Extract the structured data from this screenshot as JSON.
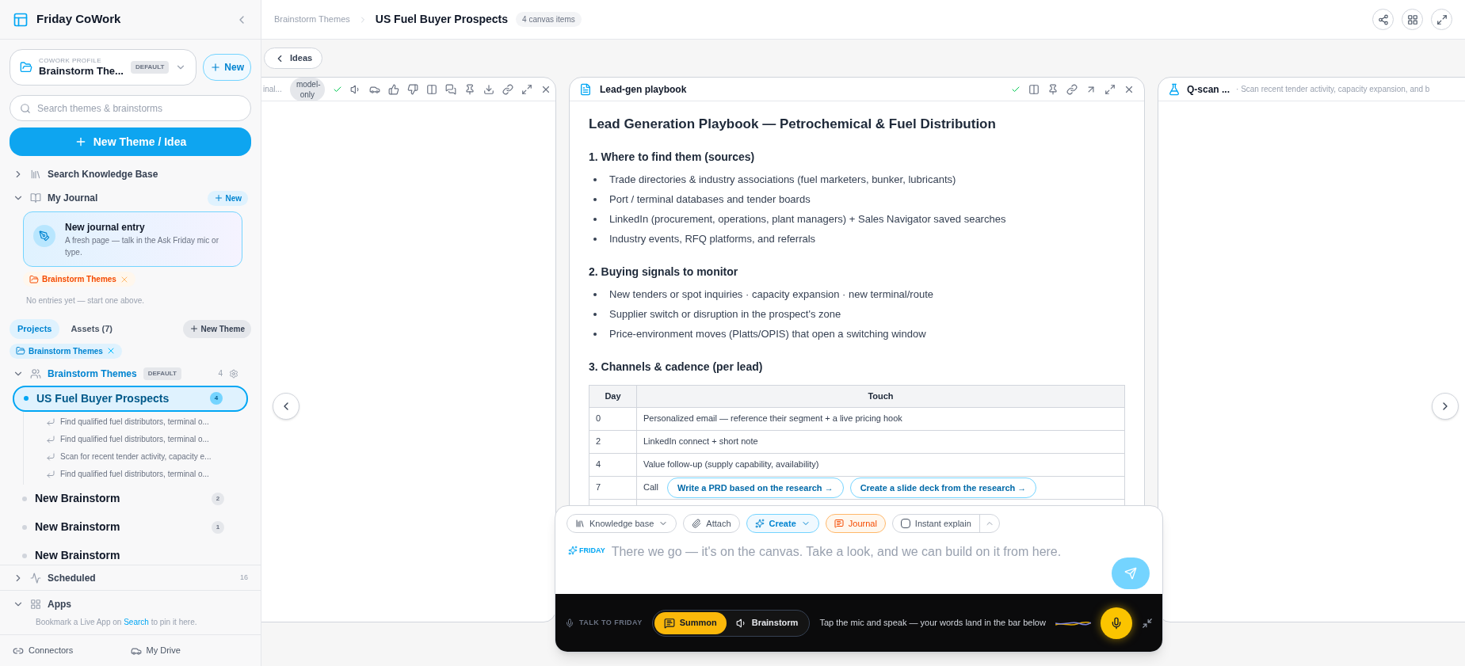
{
  "sidebar": {
    "app_title": "Friday CoWork",
    "profile": {
      "label": "COWORK PROFILE",
      "name": "Brainstorm The...",
      "badge": "DEFAULT"
    },
    "new_button": "New",
    "search": {
      "placeholder": "Search themes & brainstorms"
    },
    "primary_button": "New Theme / Idea",
    "knowledge_base": {
      "label": "Search Knowledge Base",
      "expanded": false
    },
    "journal": {
      "label": "My Journal",
      "expanded": true,
      "new_button": "New",
      "entry": {
        "title": "New journal entry",
        "text": "A fresh page — talk in the Ask Friday mic or type."
      },
      "tag": "Brainstorm Themes",
      "empty": "No entries yet — start one above."
    },
    "tabs": [
      {
        "label": "Projects",
        "selected": true
      },
      {
        "label": "Assets (7)",
        "selected": false
      }
    ],
    "new_theme_button": "New Theme",
    "filter_tag": "Brainstorm Themes",
    "theme_group": {
      "name": "Brainstorm Themes",
      "badge": "DEFAULT",
      "count": "4",
      "expanded": true,
      "items": [
        {
          "title": "US Fuel Buyer Prospects",
          "count": "4",
          "selected": true,
          "children": [
            {
              "title": "Find qualified fuel distributors, terminal o..."
            },
            {
              "title": "Find qualified fuel distributors, terminal o..."
            },
            {
              "title": "Scan for recent tender activity, capacity e..."
            },
            {
              "title": "Find qualified fuel distributors, terminal o..."
            }
          ]
        },
        {
          "title": "New Brainstorm",
          "count": "2",
          "selected": false
        },
        {
          "title": "New Brainstorm",
          "count": "1",
          "selected": false
        },
        {
          "title": "New Brainstorm",
          "selected": false
        }
      ]
    },
    "scheduled": {
      "label": "Scheduled",
      "count": "16",
      "expanded": false
    },
    "apps": {
      "label": "Apps",
      "expanded": true,
      "hint_before": "Bookmark a Live App on",
      "hint_link": "Search",
      "hint_after": "to pin it here."
    },
    "footer": [
      {
        "kind": "connectors",
        "label": "Connectors"
      },
      {
        "kind": "drive",
        "label": "My Drive"
      }
    ]
  },
  "header": {
    "breadcrumb": "Brainstorm Themes",
    "title": "US Fuel Buyer Prospects",
    "badge": "4 canvas items"
  },
  "canvas": {
    "back_button": "Ideas",
    "cards": [
      {
        "kind": "answer",
        "title": "inal...",
        "badge": "model-only"
      },
      {
        "kind": "document",
        "title": "Lead-gen playbook"
      },
      {
        "kind": "scan",
        "title": "Q-scan ...",
        "subtitle": "· Scan recent tender activity, capacity expansion, and b"
      }
    ],
    "document": {
      "title": "Lead Generation Playbook — Petrochemical & Fuel Distribution",
      "sections": [
        {
          "heading": "1. Where to find them (sources)",
          "bullets": [
            "Trade directories & industry associations (fuel marketers, bunker, lubricants)",
            "Port / terminal databases and tender boards",
            "LinkedIn (procurement, operations, plant managers) + Sales Navigator saved searches",
            "Industry events, RFQ platforms, and referrals"
          ]
        },
        {
          "heading": "2. Buying signals to monitor",
          "bullets": [
            "New tenders or spot inquiries · capacity expansion · new terminal/route",
            "Supplier switch or disruption in the prospect's zone",
            "Price-environment moves (Platts/OPIS) that open a switching window"
          ]
        },
        {
          "heading": "3. Channels & cadence (per lead)",
          "table": {
            "columns": [
              "Day",
              "Touch"
            ],
            "rows": [
              [
                "0",
                "Personalized email — reference their segment + a live pricing hook"
              ],
              [
                "2",
                "LinkedIn connect + short note"
              ],
              [
                "4",
                "Value follow-up (supply capability, availability)"
              ],
              [
                "7",
                "Call"
              ]
            ]
          }
        }
      ]
    },
    "suggestions": [
      "Write a PRD based on the research →",
      "Create a slide deck from the research →"
    ]
  },
  "composer": {
    "tools": [
      {
        "kind": "knowledge",
        "label": "Knowledge base"
      },
      {
        "kind": "attach",
        "label": "Attach"
      },
      {
        "kind": "create",
        "label": "Create"
      },
      {
        "kind": "journal",
        "label": "Journal"
      },
      {
        "kind": "checkbox",
        "label": "Instant explain",
        "checked": false
      }
    ],
    "assistant": "FRIDAY",
    "placeholder": "There we go — it's on the canvas. Take a look, and we can build on it from here."
  },
  "voice_bar": {
    "label": "TALK TO FRIDAY",
    "modes": [
      {
        "kind": "summon",
        "label": "Summon",
        "selected": true
      },
      {
        "kind": "brainstorm",
        "label": "Brainstorm",
        "selected": false
      }
    ],
    "hint": "Tap the mic and speak — your words land in the bar below"
  }
}
